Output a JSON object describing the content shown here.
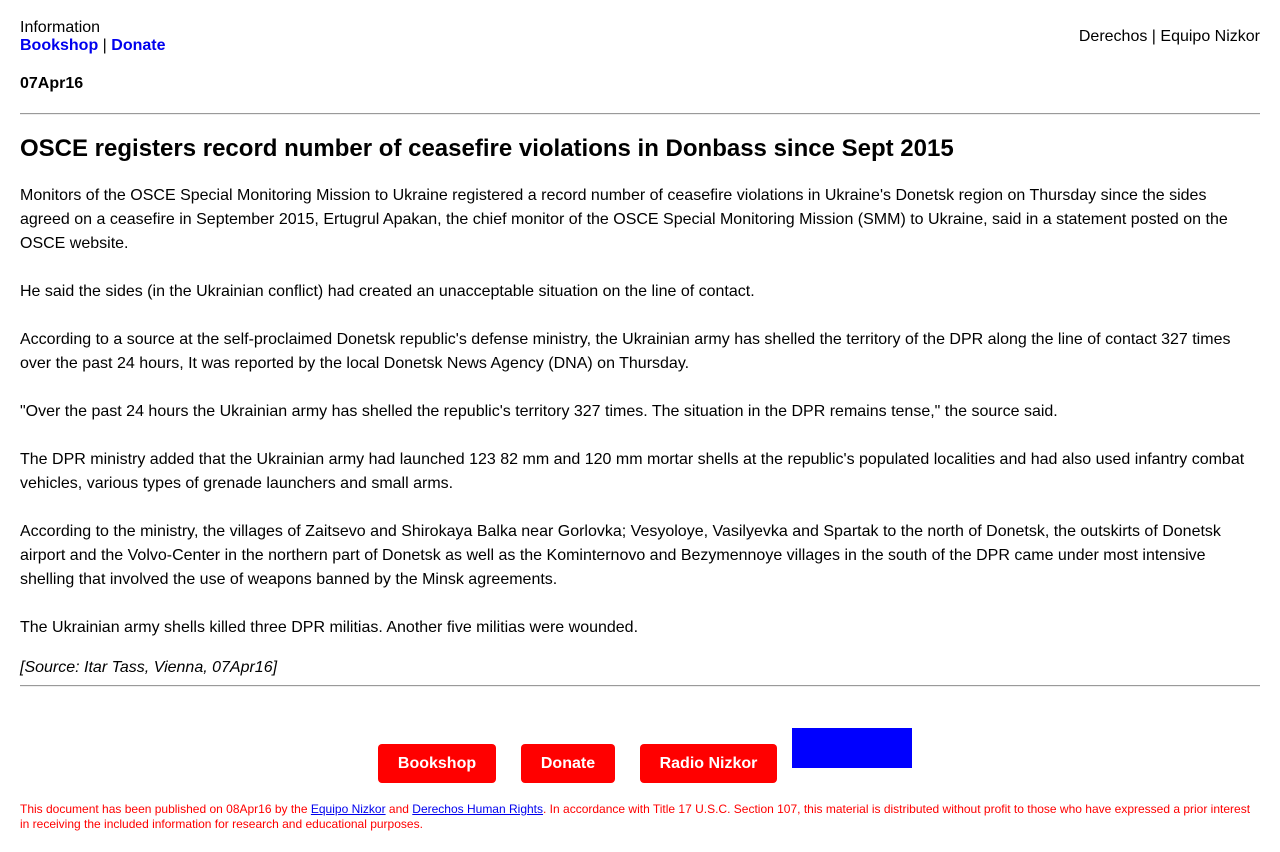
{
  "header": {
    "info_label": "Information",
    "bookshop_link": "Bookshop",
    "separator": "|",
    "donate_link": "Donate",
    "right_text": "Derechos | Equipo Nizkor"
  },
  "date": "07Apr16",
  "title": "OSCE registers record number of ceasefire violations in Donbass since Sept 2015",
  "paragraphs": [
    "Monitors of the OSCE Special Monitoring Mission to Ukraine registered a record number of ceasefire violations in Ukraine's Donetsk region on Thursday since the sides agreed on a ceasefire in September 2015, Ertugrul Apakan, the chief monitor of the OSCE Special Monitoring Mission (SMM) to Ukraine, said in a statement posted on the OSCE website.",
    "He said the sides (in the Ukrainian conflict) had created an unacceptable situation on the line of contact.",
    "According to a source at the self-proclaimed Donetsk republic's defense ministry, the Ukrainian army has shelled the territory of the DPR along the line of contact 327 times over the past 24 hours, It was reported by the local Donetsk News Agency (DNA) on Thursday.",
    "\"Over the past 24 hours the Ukrainian army has shelled the republic's territory 327 times. The situation in the DPR remains tense,\" the source said.",
    "The DPR ministry added that the Ukrainian army had launched 123 82 mm and 120 mm mortar shells at the republic's populated localities and had also used infantry combat vehicles, various types of grenade launchers and small arms.",
    "According to the ministry, the villages of Zaitsevo and Shirokaya Balka near Gorlovka; Vesyoloye, Vasilyevka and Spartak to the north of Donetsk, the outskirts of Donetsk airport and the Volvo-Center in the northern part of Donetsk as well as the Kominternovo and Bezymennoye villages in the south of the DPR came under most intensive shelling that involved the use of weapons banned by the Minsk agreements.",
    "The Ukrainian army shells killed three DPR militias. Another five militias were wounded."
  ],
  "source": "[Source: Itar Tass, Vienna, 07Apr16]",
  "footer": {
    "bookshop_button": "Bookshop",
    "donate_button": "Donate",
    "radio_button": "Radio Nizkor",
    "disclaimer_part1": "This document has been published on 08Apr16 by the ",
    "disclaimer_link1": "Equipo Nizkor",
    "disclaimer_part2": " and ",
    "disclaimer_link2": "Derechos Human Rights",
    "disclaimer_part3": ". In accordance with Title 17 U.S.C. Section 107, this material is distributed without profit to those who have expressed a prior interest in receiving the included information for research and educational purposes."
  },
  "colors": {
    "button_bg": "#ff0000",
    "link": "#0000ee",
    "blue_box": "#0000ff",
    "disclaimer": "#ff0000"
  }
}
